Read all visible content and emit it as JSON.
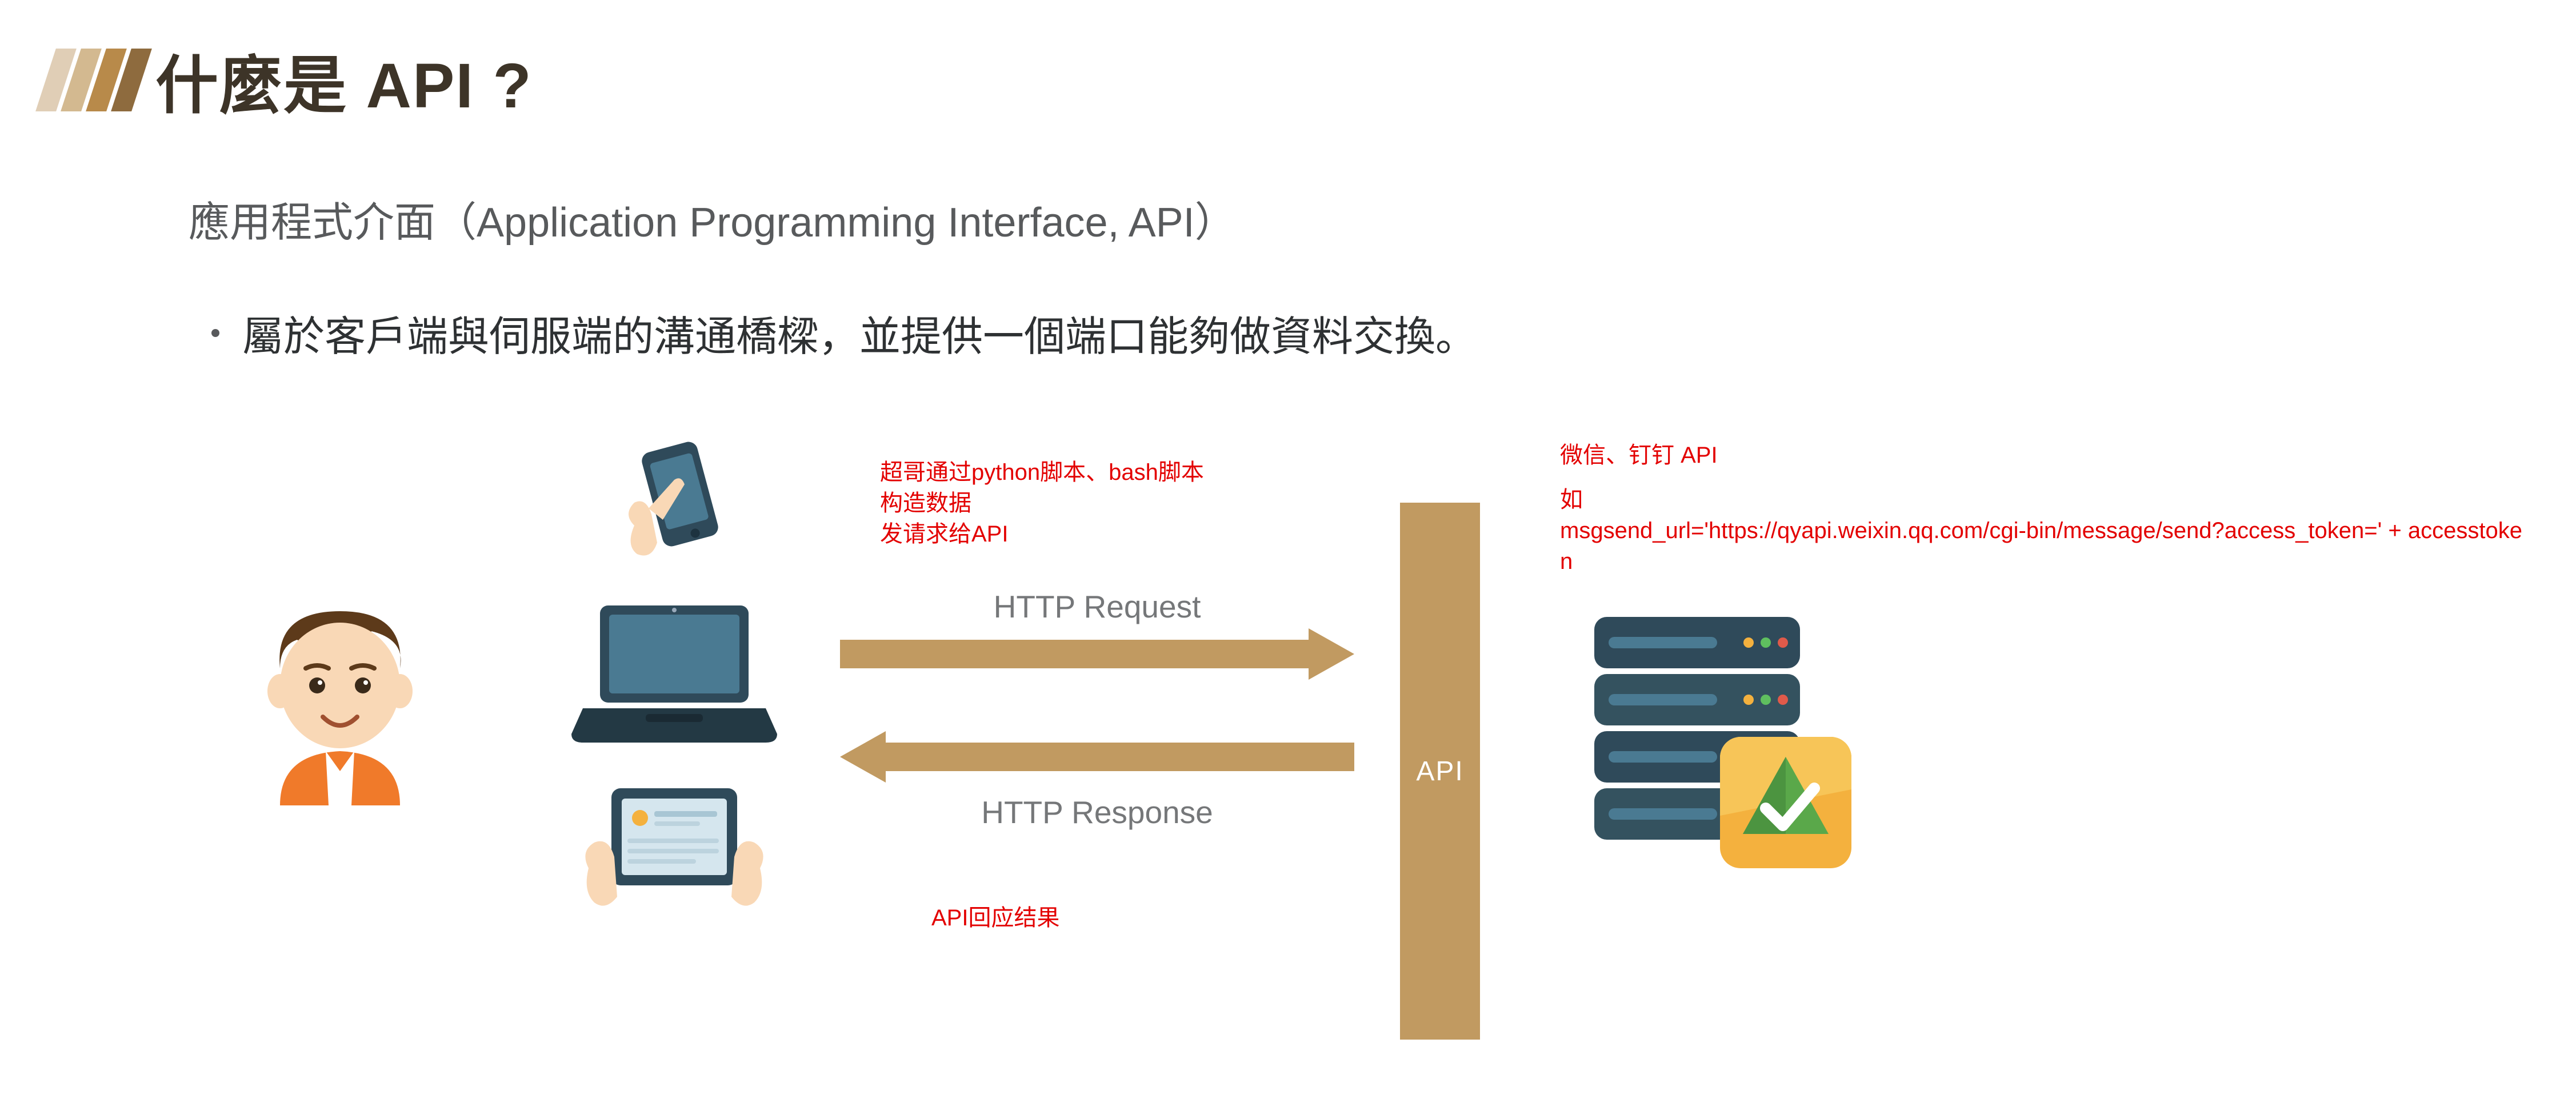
{
  "title": "什麼是 API ?",
  "subtitle": "應用程式介面（Application Programming Interface, API）",
  "bullet": "屬於客戶端與伺服端的溝通橋樑，並提供一個端口能夠做資料交換。",
  "annotations": {
    "top_left_line1": "超哥通过python脚本、bash脚本",
    "top_left_line2": "构造数据",
    "top_left_line3": "发请求给API",
    "bottom_left": "API回应结果",
    "top_right_line1": "微信、钉钉 API",
    "top_right_line2": "如",
    "top_right_line3": "msgsend_url='https://qyapi.weixin.qq.com/cgi-bin/message/send?access_token=' + accesstoken"
  },
  "arrows": {
    "request_label": "HTTP Request",
    "response_label": "HTTP Response"
  },
  "api_label": "API",
  "icons": {
    "person": "boy-avatar-icon",
    "phone": "hand-phone-icon",
    "laptop": "laptop-icon",
    "tablet": "hands-tablet-icon",
    "server": "server-check-icon"
  },
  "colors": {
    "accent_brown": "#c19a61",
    "title_dark": "#3d3428",
    "annotation_red": "#e30000"
  }
}
